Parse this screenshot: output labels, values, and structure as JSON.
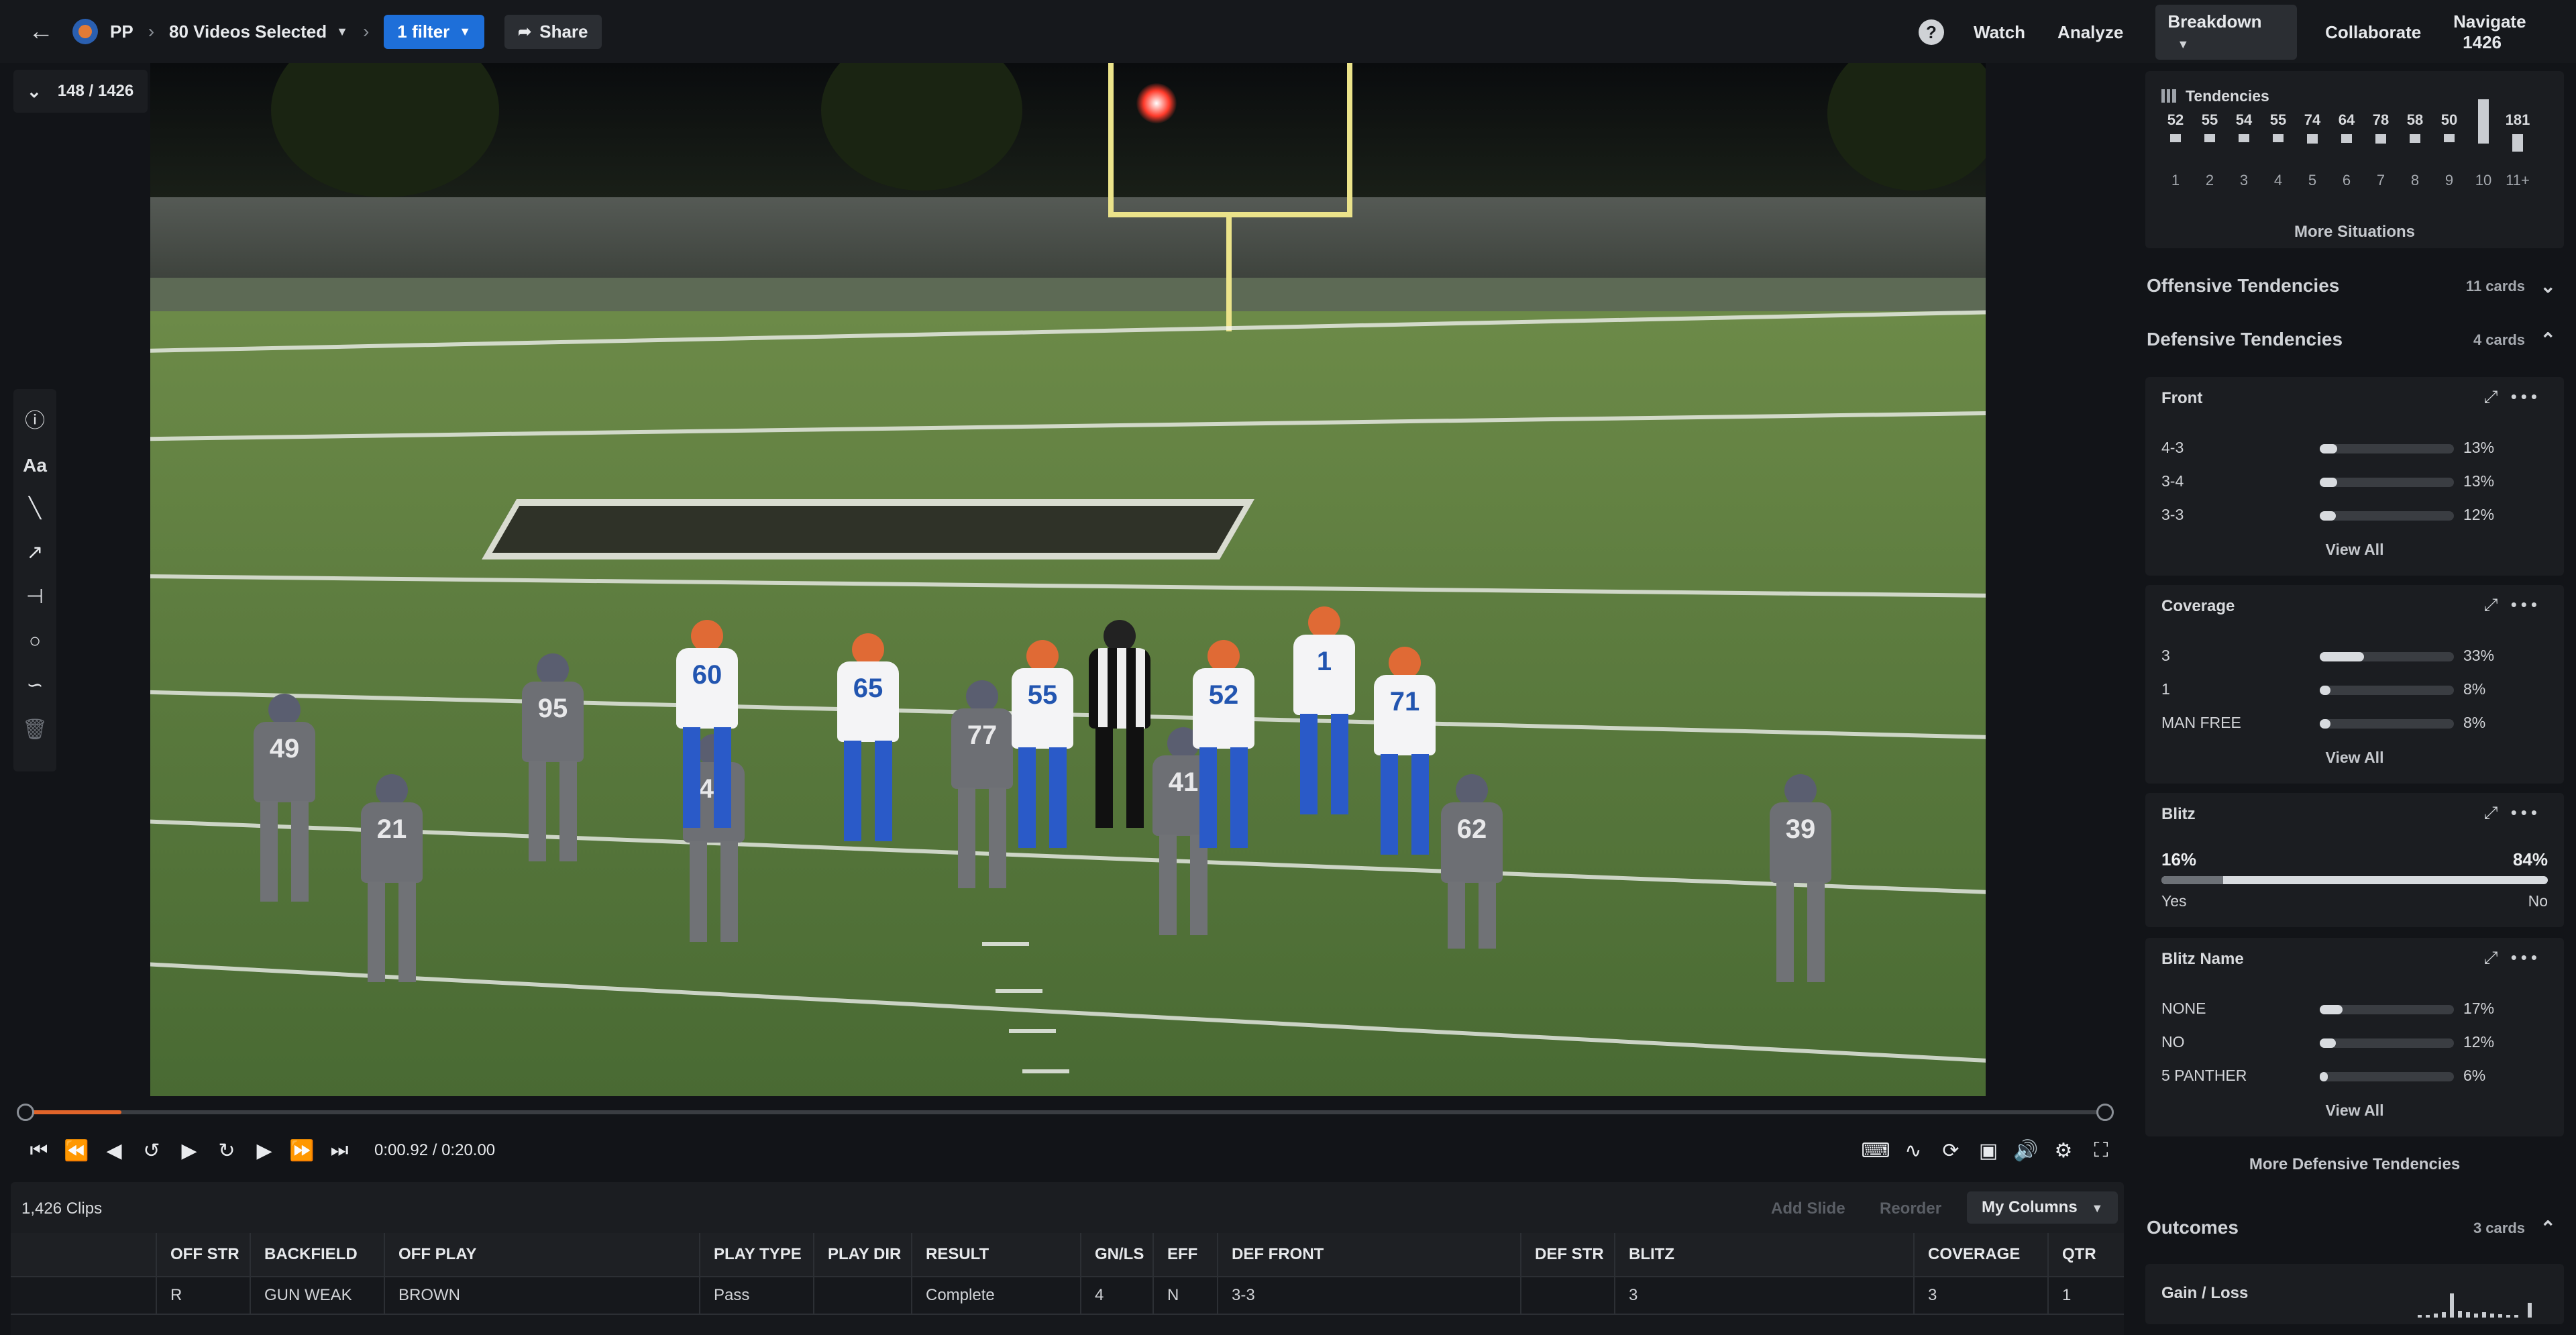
{
  "topbar": {
    "team": "PP",
    "videos_selected": "80 Videos Selected",
    "filter": "1 filter",
    "share": "Share",
    "nav": [
      "Watch",
      "Analyze",
      "Breakdown",
      "Collaborate",
      "Navigate"
    ],
    "navigate_count": "1426"
  },
  "player_counter": "148 / 1426",
  "tools": [
    "info-icon",
    "text-tool-icon",
    "line-tool-icon",
    "arrow-tool-icon",
    "t-line-tool-icon",
    "circle-tool-icon",
    "freehand-tool-icon",
    "trash-icon"
  ],
  "tools_text": "Aa",
  "video": {
    "jerseys_home": [
      "49",
      "21",
      "95",
      "44",
      "77",
      "41",
      "62",
      "39"
    ],
    "jerseys_away": [
      "60",
      "65",
      "55",
      "52",
      "1",
      "71"
    ]
  },
  "playback": {
    "time": "0:00.92 / 0:20.00",
    "progress_fraction": 0.046
  },
  "clips": {
    "count": "1,426 Clips",
    "add_slide": "Add Slide",
    "reorder": "Reorder",
    "my_columns": "My Columns",
    "columns": [
      "",
      "OFF STR",
      "BACKFIELD",
      "OFF PLAY",
      "PLAY TYPE",
      "PLAY DIR",
      "RESULT",
      "GN/LS",
      "EFF",
      "DEF FRONT",
      "DEF STR",
      "BLITZ",
      "COVERAGE",
      "QTR"
    ],
    "rows": [
      [
        "",
        "R",
        "GUN WEAK",
        "BROWN",
        "Pass",
        "",
        "Complete",
        "4",
        "N",
        "3-3",
        "",
        "3",
        "3",
        "1"
      ]
    ]
  },
  "tendencies": {
    "title": "Tendencies",
    "downs": [
      {
        "label": "1",
        "value": "52",
        "level": 0.1
      },
      {
        "label": "2",
        "value": "55",
        "level": 0.1
      },
      {
        "label": "3",
        "value": "54",
        "level": 0.1
      },
      {
        "label": "4",
        "value": "55",
        "level": 0.1
      },
      {
        "label": "5",
        "value": "74",
        "level": 0.13
      },
      {
        "label": "6",
        "value": "64",
        "level": 0.12
      },
      {
        "label": "7",
        "value": "78",
        "level": 0.14
      },
      {
        "label": "8",
        "value": "58",
        "level": 0.11
      },
      {
        "label": "9",
        "value": "50",
        "level": 0.1
      },
      {
        "label": "10",
        "value": "",
        "level": 1.0
      },
      {
        "label": "11+",
        "value": "181",
        "level": 0.33
      }
    ],
    "more_situations": "More Situations"
  },
  "offensive": {
    "title": "Offensive Tendencies",
    "cards": "11 cards"
  },
  "defensive": {
    "title": "Defensive Tendencies",
    "cards": "4 cards",
    "front": {
      "title": "Front",
      "rows": [
        {
          "label": "4-3",
          "pct": "13%",
          "value": 0.13
        },
        {
          "label": "3-4",
          "pct": "13%",
          "value": 0.13
        },
        {
          "label": "3-3",
          "pct": "12%",
          "value": 0.12
        }
      ],
      "view_all": "View All"
    },
    "coverage": {
      "title": "Coverage",
      "rows": [
        {
          "label": "3",
          "pct": "33%",
          "value": 0.33
        },
        {
          "label": "1",
          "pct": "8%",
          "value": 0.08
        },
        {
          "label": "MAN FREE",
          "pct": "8%",
          "value": 0.08
        }
      ],
      "view_all": "View All"
    },
    "blitz": {
      "title": "Blitz",
      "yes_pct": "16%",
      "no_pct": "84%",
      "yes_value": 0.16,
      "yes_label": "Yes",
      "no_label": "No"
    },
    "blitz_name": {
      "title": "Blitz Name",
      "rows": [
        {
          "label": "NONE",
          "pct": "17%",
          "value": 0.17
        },
        {
          "label": "NO",
          "pct": "12%",
          "value": 0.12
        },
        {
          "label": "5 PANTHER",
          "pct": "6%",
          "value": 0.06
        }
      ],
      "view_all": "View All"
    },
    "more": "More Defensive Tendencies"
  },
  "outcomes": {
    "title": "Outcomes",
    "cards": "3 cards",
    "gain_loss": "Gain / Loss"
  }
}
